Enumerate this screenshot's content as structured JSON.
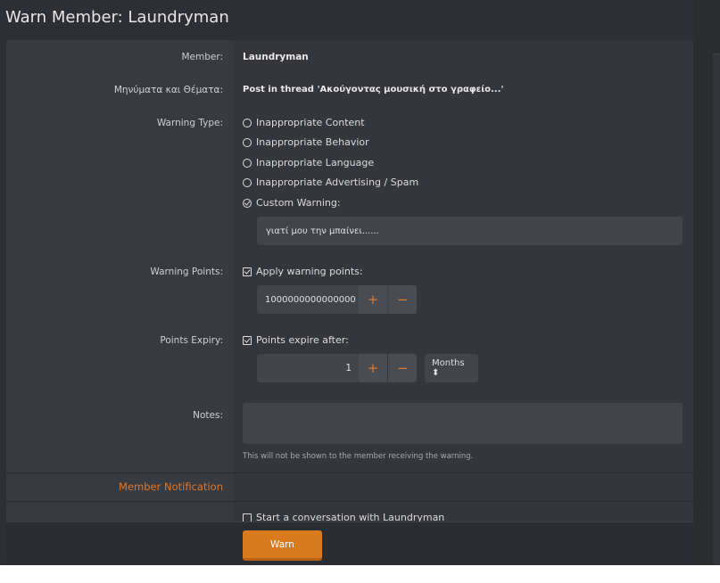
{
  "title": "Warn Member: Laundryman",
  "member": {
    "label": "Member:",
    "value": "Laundryman"
  },
  "content": {
    "label": "Μηνύματα και Θέματα:",
    "value": "Post in thread 'Ακούγοντας μουσική στο γραφείο...'"
  },
  "warning_type": {
    "label": "Warning Type:",
    "options": [
      {
        "label": "Inappropriate Content",
        "selected": false
      },
      {
        "label": "Inappropriate Behavior",
        "selected": false
      },
      {
        "label": "Inappropriate Language",
        "selected": false
      },
      {
        "label": "Inappropriate Advertising / Spam",
        "selected": false
      },
      {
        "label": "Custom Warning:",
        "selected": true
      }
    ],
    "custom_value": "γιατί μου την μπαίνει......"
  },
  "warning_points": {
    "label": "Warning Points:",
    "checkbox_label": "Apply warning points:",
    "checked": true,
    "value": "1000000000000000",
    "plus": "+",
    "minus": "−"
  },
  "points_expiry": {
    "label": "Points Expiry:",
    "checkbox_label": "Points expire after:",
    "checked": true,
    "value": "1",
    "plus": "+",
    "minus": "−",
    "unit": "Months ⬍"
  },
  "notes": {
    "label": "Notes:",
    "value": "",
    "hint": "This will not be shown to the member receiving the warning."
  },
  "member_notification": {
    "heading": "Member Notification",
    "start_conversation": "Start a conversation with Laundryman",
    "checked": false
  },
  "submit": "Warn",
  "colors": {
    "accent": "#d97a1e",
    "heading": "#e0782a"
  }
}
